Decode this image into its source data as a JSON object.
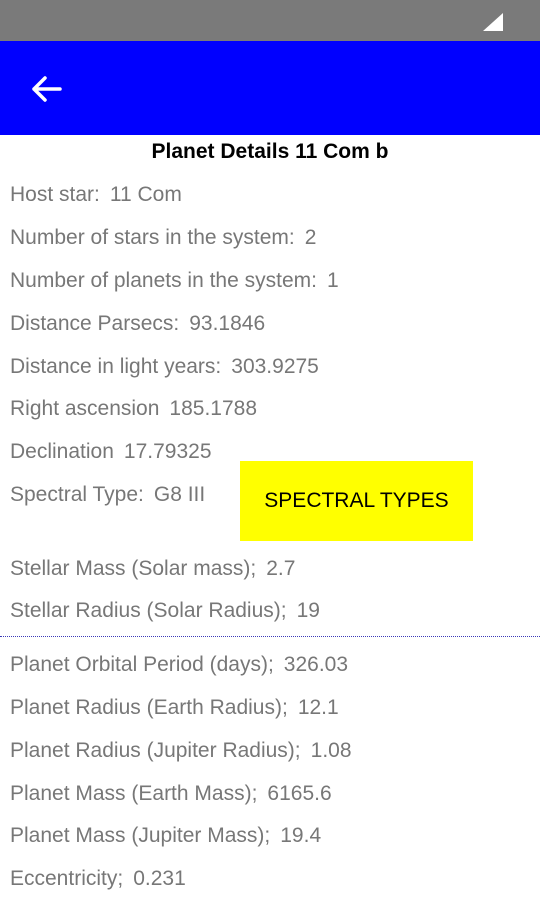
{
  "status_bar": {
    "signal_icon": "signal-icon"
  },
  "app_bar": {
    "back_icon": "arrow-left-icon",
    "color": "#0000ff"
  },
  "page": {
    "title": "Planet Details 11 Com b"
  },
  "star_details": [
    {
      "label": "Host star:",
      "value": "11 Com"
    },
    {
      "label": "Number of stars in the system:",
      "value": "2"
    },
    {
      "label": "Number of planets in the system:",
      "value": "1"
    },
    {
      "label": "Distance Parsecs:",
      "value": "93.1846"
    },
    {
      "label": "Distance in light years:",
      "value": "303.9275"
    },
    {
      "label": "Right ascension",
      "value": "185.1788"
    },
    {
      "label": "Declination",
      "value": "17.79325"
    },
    {
      "label": "Spectral Type:",
      "value": "G8 III"
    },
    {
      "label": "Stellar Mass (Solar mass);",
      "value": "2.7"
    },
    {
      "label": "Stellar Radius (Solar Radius);",
      "value": "19"
    }
  ],
  "spectral_button": {
    "label": "SPECTRAL TYPES",
    "color": "#ffff00"
  },
  "planet_details": [
    {
      "label": "Planet Orbital Period (days);",
      "value": "326.03"
    },
    {
      "label": "Planet Radius (Earth Radius);",
      "value": "12.1"
    },
    {
      "label": "Planet Radius (Jupiter Radius);",
      "value": "1.08"
    },
    {
      "label": "Planet Mass (Earth Mass);",
      "value": "6165.6"
    },
    {
      "label": "Planet Mass (Jupiter Mass);",
      "value": "19.4"
    },
    {
      "label": "Eccentricity;",
      "value": "0.231"
    }
  ]
}
